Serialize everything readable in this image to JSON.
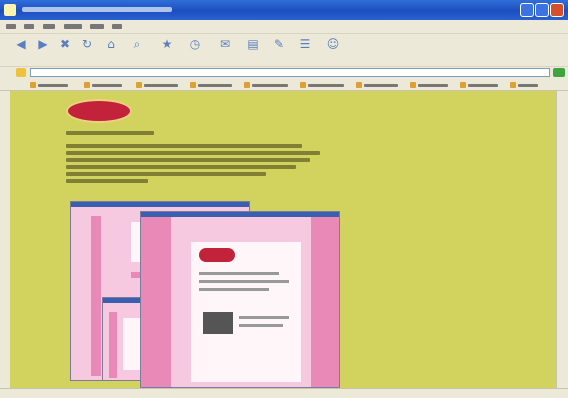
{
  "window": {
    "title": "",
    "colors": {
      "titlebar": "#1d4fbf",
      "chrome": "#ece9d8",
      "close": "#d4502d"
    }
  },
  "menu": {
    "items": [
      "",
      "",
      "",
      "",
      "",
      ""
    ]
  },
  "toolbar": {
    "buttons": [
      {
        "label": "",
        "icon": "back-icon"
      },
      {
        "label": "",
        "icon": "forward-icon"
      },
      {
        "label": "",
        "icon": "stop-icon"
      },
      {
        "label": "",
        "icon": "refresh-icon"
      },
      {
        "label": "",
        "icon": "home-icon"
      },
      {
        "label": "",
        "icon": "search-icon"
      },
      {
        "label": "",
        "icon": "favorites-icon"
      },
      {
        "label": "",
        "icon": "history-icon"
      },
      {
        "label": "",
        "icon": "mail-icon"
      },
      {
        "label": "",
        "icon": "print-icon"
      },
      {
        "label": "",
        "icon": "edit-icon"
      },
      {
        "label": "",
        "icon": "discuss-icon"
      },
      {
        "label": "",
        "icon": "messenger-icon"
      }
    ]
  },
  "address": {
    "label": "",
    "value": ""
  },
  "links": {
    "items": [
      "",
      "",
      "",
      "",
      "",
      "",
      "",
      "",
      "",
      ""
    ]
  },
  "page": {
    "background": "#d2d35e",
    "logo_text": "",
    "heading": "",
    "paragraph_lines": [
      "",
      "",
      "",
      "",
      "",
      ""
    ],
    "screenshot_colors": {
      "pink": "#f7c9e1",
      "accent": "#e889b8"
    }
  },
  "status": {
    "text": "",
    "zone": ""
  }
}
